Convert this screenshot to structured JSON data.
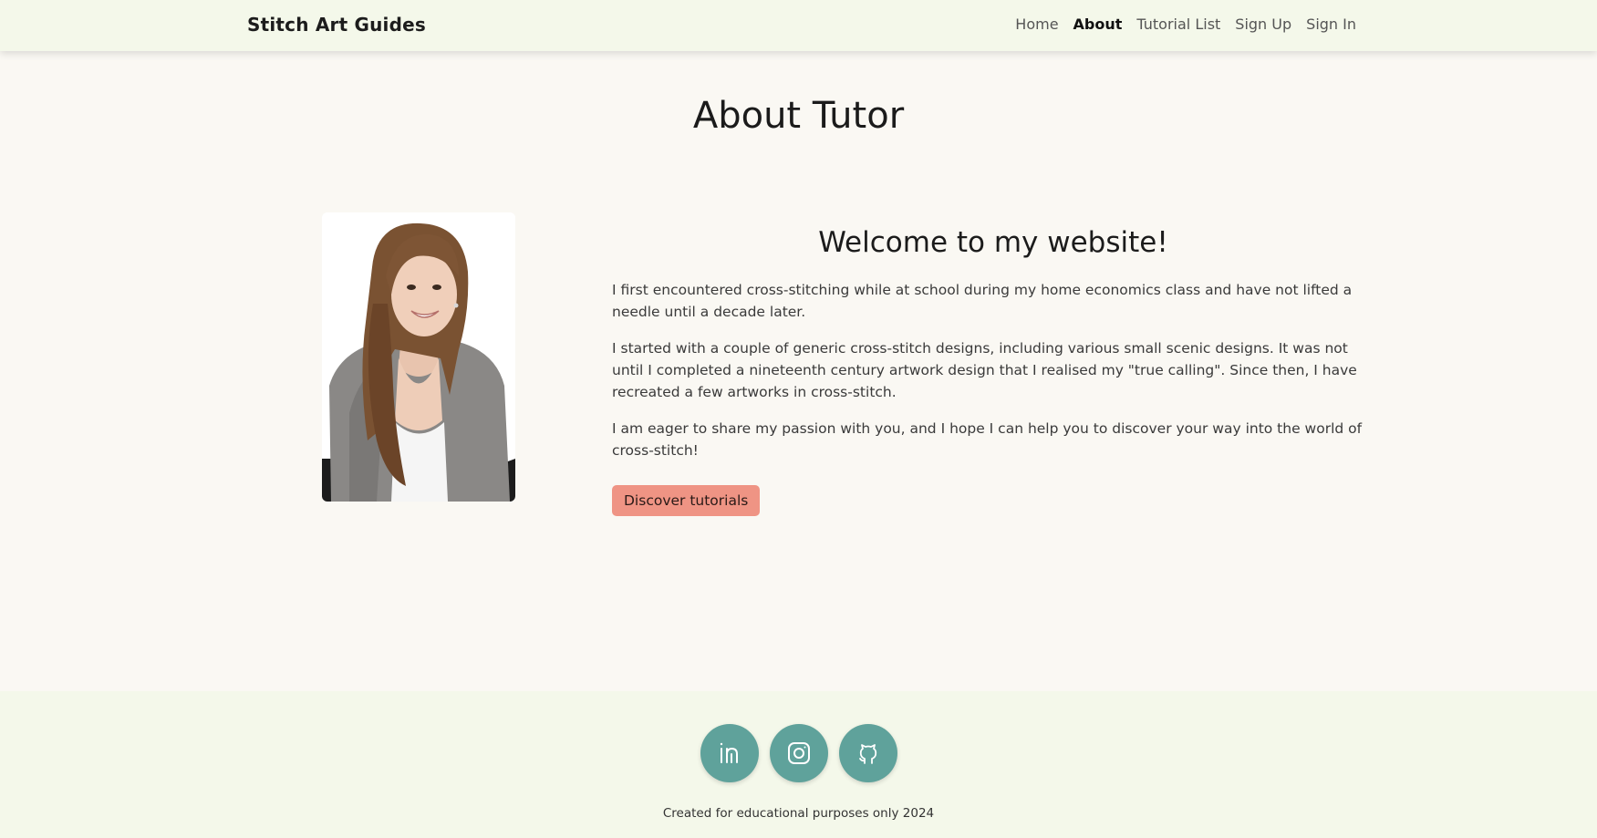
{
  "nav": {
    "brand": "Stitch Art Guides",
    "links": [
      {
        "label": "Home",
        "active": false
      },
      {
        "label": "About",
        "active": true
      },
      {
        "label": "Tutorial List",
        "active": false
      },
      {
        "label": "Sign Up",
        "active": false
      },
      {
        "label": "Sign In",
        "active": false
      }
    ]
  },
  "main": {
    "title": "About Tutor",
    "welcome": "Welcome to my website!",
    "paragraphs": [
      "I first encountered cross-stitching while at school during my home economics class and have not lifted a needle until a decade later.",
      "I started with a couple of generic cross-stitch designs, including various small scenic designs. It was not until I completed a nineteenth century artwork design that I realised my \"true calling\". Since then, I have recreated a few artworks in cross-stitch.",
      "I am eager to share my passion with you, and I hope I can help you to discover your way into the world of cross-stitch!"
    ],
    "cta_label": "Discover tutorials"
  },
  "footer": {
    "socials": [
      "linkedin-icon",
      "instagram-icon",
      "github-icon"
    ],
    "text": "Created for educational purposes only 2024"
  },
  "colors": {
    "nav_bg": "#f4f8ea",
    "page_bg": "#faf8f3",
    "cta_bg": "#ef9484",
    "social_bg": "#5fa29b"
  }
}
